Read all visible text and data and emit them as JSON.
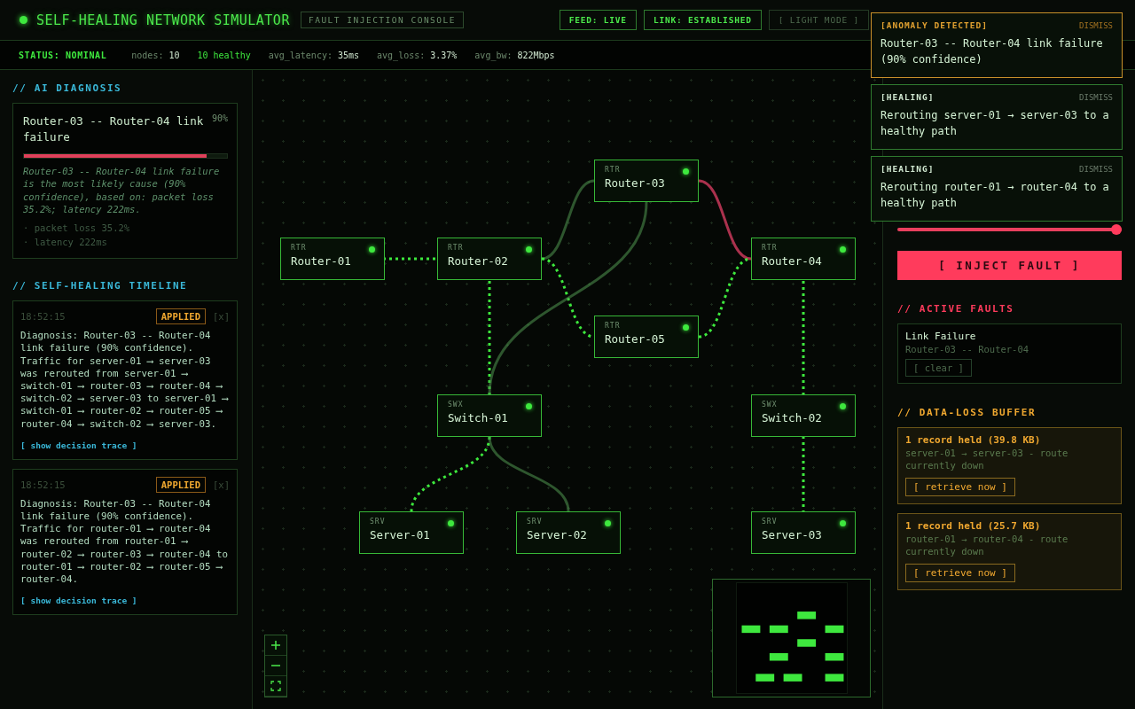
{
  "header": {
    "title": "SELF-HEALING NETWORK SIMULATOR",
    "subtitle": "FAULT INJECTION CONSOLE",
    "badges": [
      {
        "label": "FEED: LIVE",
        "kind": "status"
      },
      {
        "label": "LINK: ESTABLISHED",
        "kind": "status"
      },
      {
        "label": "[ LIGHT MODE ]",
        "kind": "toggle"
      }
    ]
  },
  "status_bar": {
    "status": "STATUS: NOMINAL",
    "stats": [
      {
        "kind": "metric",
        "label": "nodes:",
        "value": "10"
      },
      {
        "kind": "healthy",
        "value": "10 healthy"
      },
      {
        "kind": "metric",
        "label": "avg_latency:",
        "value": "35ms"
      },
      {
        "kind": "metric",
        "label": "avg_loss:",
        "value": "3.37%"
      },
      {
        "kind": "metric",
        "label": "avg_bw:",
        "value": "822Mbps"
      }
    ]
  },
  "diagnosis": {
    "heading": "// AI DIAGNOSIS",
    "title": "Router-03 -- Router-04 link failure",
    "confidence": "90%",
    "level": 0.9,
    "explanation": "Router-03 -- Router-04 link failure is the most likely cause (90% confidence), based on: packet loss 35.2%; latency 222ms.",
    "evidence": [
      "· packet loss 35.2%",
      "· latency 222ms"
    ]
  },
  "timeline": {
    "heading": "// SELF-HEALING TIMELINE",
    "entries": [
      {
        "time": "18:52:15",
        "badge": "APPLIED",
        "close": "[x]",
        "text": "Diagnosis: Router-03 -- Router-04 link failure (90% confidence). Traffic for server-01 ⟶ server-03 was rerouted from server-01 ⟶ switch-01 ⟶ router-03 ⟶ router-04 ⟶ switch-02 ⟶ server-03 to server-01 ⟶ switch-01 ⟶ router-02 ⟶ router-05 ⟶ router-04 ⟶ switch-02 ⟶ server-03.",
        "link": "[ show decision trace ]"
      },
      {
        "time": "18:52:15",
        "badge": "APPLIED",
        "close": "[x]",
        "text": "Diagnosis: Router-03 -- Router-04 link failure (90% confidence). Traffic for router-01 ⟶ router-04 was rerouted from router-01 ⟶ router-02 ⟶ router-03 ⟶ router-04 to router-01 ⟶ router-02 ⟶ router-05 ⟶ router-04.",
        "link": "[ show decision trace ]"
      }
    ]
  },
  "topology": {
    "nodes": [
      {
        "type": "RTR",
        "name": "Router-01",
        "healthy": true
      },
      {
        "type": "RTR",
        "name": "Router-02",
        "healthy": true
      },
      {
        "type": "RTR",
        "name": "Router-03",
        "healthy": true
      },
      {
        "type": "RTR",
        "name": "Router-04",
        "healthy": true
      },
      {
        "type": "RTR",
        "name": "Router-05",
        "healthy": true
      },
      {
        "type": "SWX",
        "name": "Switch-01",
        "healthy": true
      },
      {
        "type": "SWX",
        "name": "Switch-02",
        "healthy": true
      },
      {
        "type": "SRV",
        "name": "Server-01",
        "healthy": true
      },
      {
        "type": "SRV",
        "name": "Server-02",
        "healthy": true
      },
      {
        "type": "SRV",
        "name": "Server-03",
        "healthy": true
      }
    ],
    "links": [
      {
        "carrying_traffic": true,
        "failed": false
      },
      {
        "carrying_traffic": false,
        "failed": false
      },
      {
        "carrying_traffic": false,
        "failed": true
      },
      {
        "carrying_traffic": true,
        "failed": false
      },
      {
        "carrying_traffic": true,
        "failed": false
      },
      {
        "carrying_traffic": true,
        "failed": false
      },
      {
        "carrying_traffic": true,
        "failed": false
      },
      {
        "carrying_traffic": false,
        "failed": false
      },
      {
        "carrying_traffic": true,
        "failed": false
      },
      {
        "carrying_traffic": false,
        "failed": false
      },
      {
        "carrying_traffic": true,
        "failed": false
      }
    ]
  },
  "controls": {
    "severity": {
      "level": 1.0
    },
    "inject_button": "[ INJECT FAULT ]"
  },
  "active_faults": {
    "heading": "// ACTIVE FAULTS",
    "items": [
      {
        "title": "Link Failure",
        "target": "Router-03 -- Router-04",
        "action": "[ clear ]"
      }
    ]
  },
  "buffer": {
    "heading": "// DATA-LOSS BUFFER",
    "items": [
      {
        "title": "1 record held (39.8 KB)",
        "detail": "server-01 → server-03 - route currently down",
        "action": "[ retrieve now ]"
      },
      {
        "title": "1 record held (25.7 KB)",
        "detail": "router-01 → router-04 - route currently down",
        "action": "[ retrieve now ]"
      }
    ]
  },
  "toasts": [
    {
      "kind": "anomaly",
      "tag": "[ANOMALY DETECTED]",
      "dismiss": "DISMISS",
      "message": "Router-03 -- Router-04 link failure (90% confidence)"
    },
    {
      "kind": "healing",
      "tag": "[HEALING]",
      "dismiss": "DISMISS",
      "message": "Rerouting server-01 → server-03 to a healthy path"
    },
    {
      "kind": "healing",
      "tag": "[HEALING]",
      "dismiss": "DISMISS",
      "message": "Rerouting router-01 → router-04 to a healthy path"
    }
  ]
}
